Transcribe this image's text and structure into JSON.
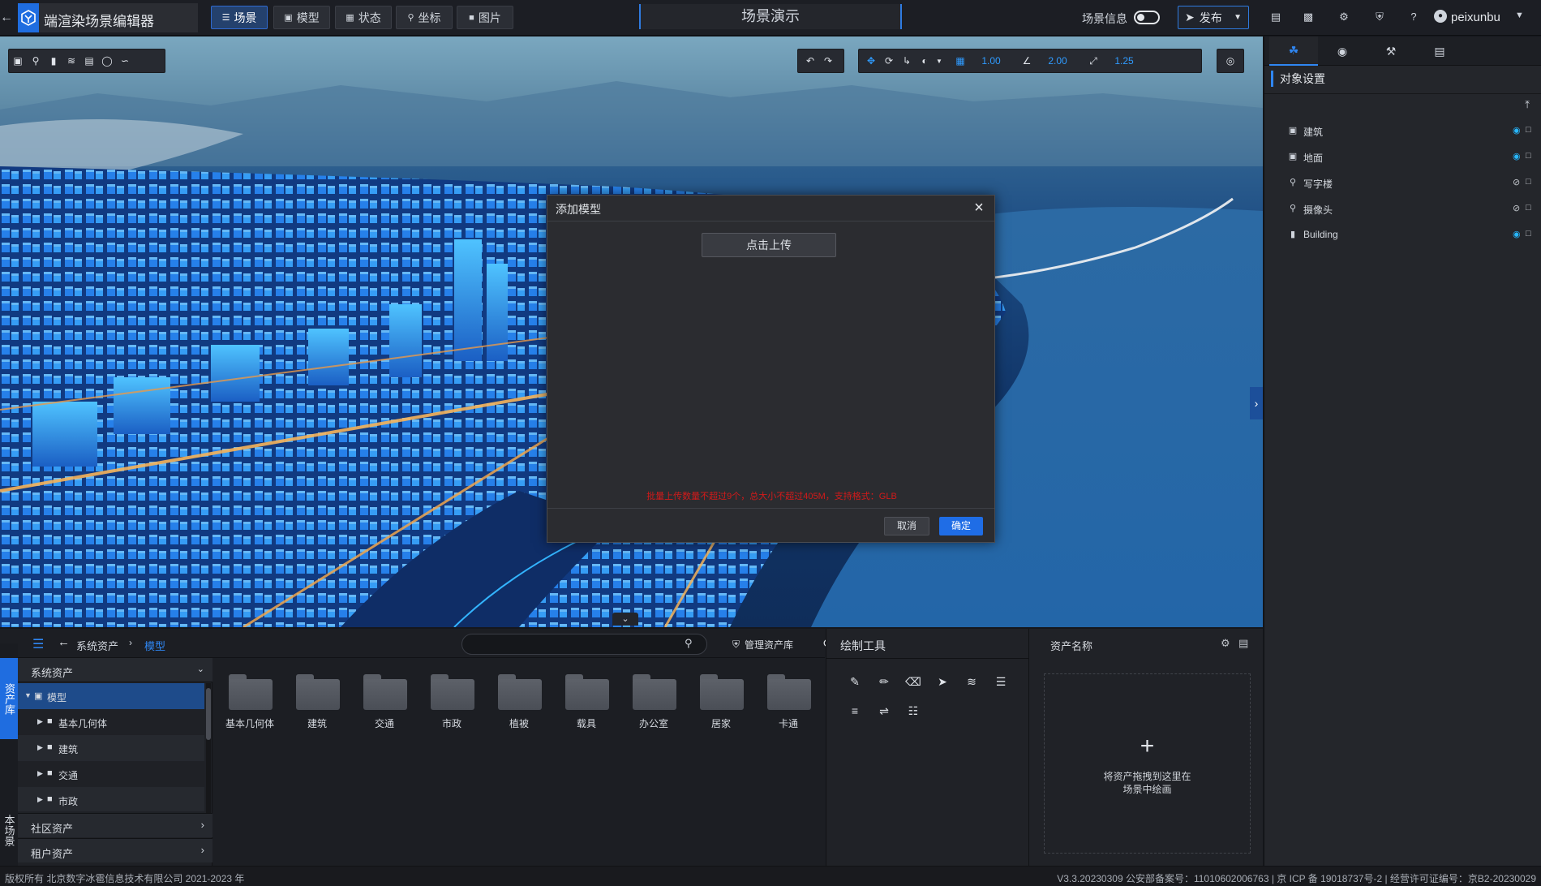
{
  "app": {
    "title": "端渲染场景编辑器",
    "scene_title": "场景演示",
    "accent_color": "#1f6de0"
  },
  "topnav": {
    "tabs": [
      {
        "label": "场景",
        "icon": "layers-icon",
        "active": true
      },
      {
        "label": "模型",
        "icon": "cube-icon",
        "active": false
      },
      {
        "label": "状态",
        "icon": "grid-icon",
        "active": false
      },
      {
        "label": "坐标",
        "icon": "pin-icon",
        "active": false
      },
      {
        "label": "图片",
        "icon": "image-icon",
        "active": false
      }
    ],
    "scene_info_label": "场景信息",
    "publish_label": "发布",
    "username": "peixunbu"
  },
  "viewport": {
    "transform_values": [
      "1.00",
      "2.00",
      "1.25"
    ]
  },
  "modal": {
    "title": "添加模型",
    "upload_label": "点击上传",
    "hint": "批量上传数量不超过9个，总大小不超过405M，支持格式：GLB",
    "cancel_label": "取消",
    "ok_label": "确定"
  },
  "right_panel": {
    "section_title": "对象设置",
    "items": [
      {
        "label": "建筑",
        "icon": "cube-icon",
        "visible": true
      },
      {
        "label": "地面",
        "icon": "cube-icon",
        "visible": true
      },
      {
        "label": "写字楼",
        "icon": "pin-icon",
        "visible": false
      },
      {
        "label": "摄像头",
        "icon": "pin-icon",
        "visible": false
      },
      {
        "label": "Building",
        "icon": "building-icon",
        "visible": true
      }
    ]
  },
  "bottom": {
    "left_tabs": [
      "资产库",
      "本场景"
    ],
    "breadcrumb": [
      "系统资产",
      "模型"
    ],
    "search_value": "",
    "manage_label": "管理资产库",
    "tree": {
      "root": "系统资产",
      "items": [
        {
          "label": "模型",
          "level": 0,
          "expanded": true,
          "selected": true
        },
        {
          "label": "基本几何体",
          "level": 1
        },
        {
          "label": "建筑",
          "level": 1
        },
        {
          "label": "交通",
          "level": 1
        },
        {
          "label": "市政",
          "level": 1
        }
      ],
      "sections": [
        "社区资产",
        "租户资产"
      ]
    },
    "folders": [
      "基本几何体",
      "建筑",
      "交通",
      "市政",
      "植被",
      "载具",
      "办公室",
      "居家",
      "卡通"
    ],
    "draw_tools_title": "绘制工具",
    "asset_name_title": "资产名称",
    "drop_text": "将资产拖拽到这里在\n场景中绘画"
  },
  "status": {
    "copyright": "版权所有 北京数字冰雹信息技术有限公司 2021-2023 年",
    "version": "V3.3.20230309 公安部备案号：11010602006763 | 京 ICP 备 19018737号-2 | 经营许可证编号：京B2-20230029"
  }
}
